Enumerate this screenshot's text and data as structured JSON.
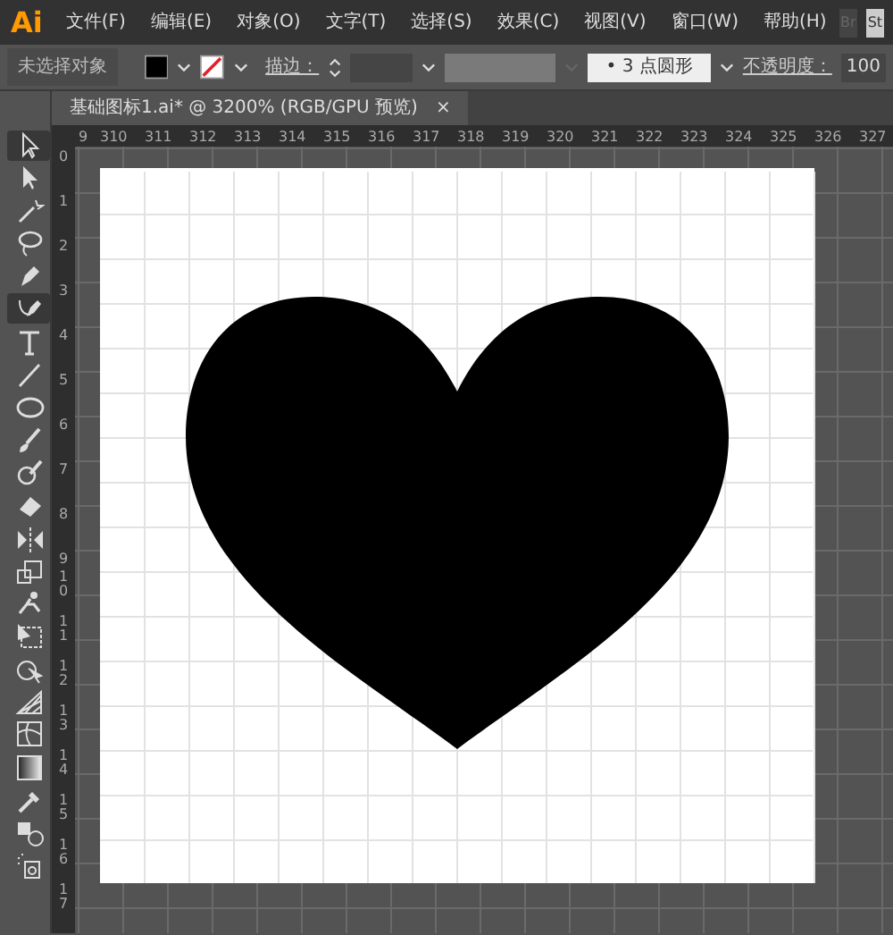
{
  "app": {
    "logo": "Ai",
    "menu": [
      "文件(F)",
      "编辑(E)",
      "对象(O)",
      "文字(T)",
      "选择(S)",
      "效果(C)",
      "视图(V)",
      "窗口(W)",
      "帮助(H)"
    ],
    "app_buttons": [
      "Br",
      "St"
    ]
  },
  "control_bar": {
    "selection": "未选择对象",
    "stroke_label": "描边：",
    "brush": "• 3 点圆形",
    "opacity_label": "不透明度：",
    "opacity": "100"
  },
  "document_tab": {
    "title": "基础图标1.ai* @ 3200% (RGB/GPU 预览)",
    "close": "×"
  },
  "ruler_h": [
    "9",
    "310",
    "311",
    "312",
    "313",
    "314",
    "315",
    "316",
    "317",
    "318",
    "319",
    "320",
    "321",
    "322",
    "323",
    "324",
    "325",
    "326",
    "327"
  ],
  "ruler_v": [
    "0",
    "1",
    "2",
    "3",
    "4",
    "5",
    "6",
    "7",
    "8",
    "9",
    "10",
    "11",
    "12",
    "13",
    "14",
    "15",
    "16",
    "17"
  ],
  "tools": [
    {
      "kind": "selection",
      "selected": true
    },
    {
      "kind": "direct",
      "selected": false
    },
    {
      "kind": "wand",
      "selected": false
    },
    {
      "kind": "lasso",
      "selected": false
    },
    {
      "kind": "pen",
      "selected": false
    },
    {
      "kind": "curvature",
      "selected": true
    },
    {
      "kind": "type",
      "selected": false
    },
    {
      "kind": "line",
      "selected": false
    },
    {
      "kind": "ellipse",
      "selected": false
    },
    {
      "kind": "brush",
      "selected": false
    },
    {
      "kind": "blob",
      "selected": false
    },
    {
      "kind": "eraser",
      "selected": false
    },
    {
      "kind": "reflect",
      "selected": false
    },
    {
      "kind": "scale",
      "selected": false
    },
    {
      "kind": "puppet",
      "selected": false
    },
    {
      "kind": "transform",
      "selected": false
    },
    {
      "kind": "builder",
      "selected": false
    },
    {
      "kind": "perspective",
      "selected": false
    },
    {
      "kind": "mesh",
      "selected": false
    },
    {
      "kind": "gradient",
      "selected": false
    },
    {
      "kind": "eyedropper",
      "selected": false
    },
    {
      "kind": "blend",
      "selected": false
    },
    {
      "kind": "sprayer",
      "selected": false
    }
  ]
}
